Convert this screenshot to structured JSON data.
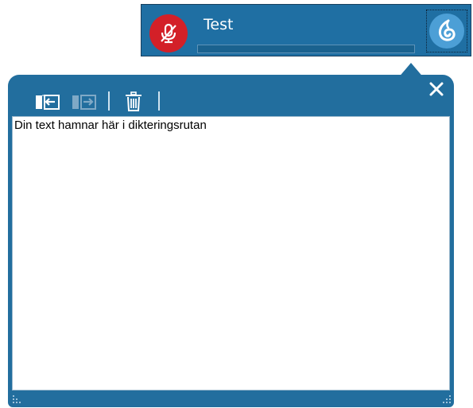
{
  "topbar": {
    "profile_name": "Test",
    "icons": {
      "microphone": "microphone-off-icon",
      "dragon": "dragon-logo-icon"
    },
    "colors": {
      "bar": "#1f6fa3",
      "mic_off": "#d32028",
      "dragon": "#4c9fd6"
    }
  },
  "dictation_box": {
    "toolbar": {
      "transfer_button_icon": "transfer-text-icon",
      "transfer_disabled_button_icon": "transfer-text-disabled-icon",
      "delete_button_icon": "trash-icon"
    },
    "close_icon": "close-icon",
    "text": "Din text hamnar här i dikteringsrutan"
  }
}
